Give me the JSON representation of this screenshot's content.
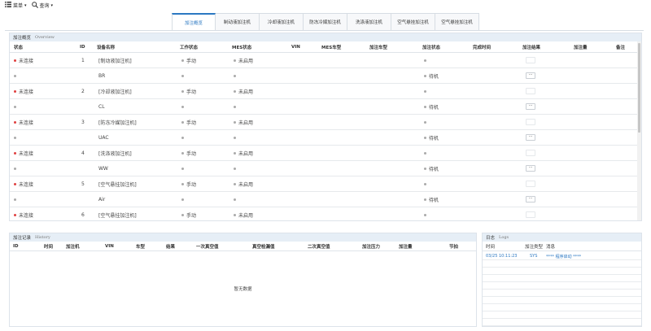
{
  "menubar": {
    "menu_label": "菜单",
    "query_label": "查询"
  },
  "tabs": [
    "加注概览",
    "制动液加注机",
    "冷却液加注机",
    "防冻冷媒加注机",
    "洗涤液加注机",
    "空气悬挂加注机",
    "空气悬挂加注机"
  ],
  "overview": {
    "title": "加注概览",
    "title_en": "Overview",
    "columns": [
      "状态",
      "ID",
      "设备名称",
      "工作状态",
      "MES状态",
      "VIN",
      "MES车型",
      "加注车型",
      "加注状态",
      "完成时间",
      "加注结果",
      "加注量",
      "备注"
    ],
    "rows": [
      {
        "status": "未连接",
        "status_dot": "red",
        "id": "1",
        "name": "[制动液加注机]",
        "work": "手动",
        "mes": "未启用",
        "fill_state": "",
        "button": "empty"
      },
      {
        "status": "",
        "status_dot": "gray",
        "id": "",
        "name": "BR",
        "work": "",
        "mes": "",
        "fill_state": "待机",
        "button": "dots"
      },
      {
        "status": "未连接",
        "status_dot": "red",
        "id": "2",
        "name": "[冷却液加注机]",
        "work": "手动",
        "mes": "未启用",
        "fill_state": "",
        "button": "empty"
      },
      {
        "status": "",
        "status_dot": "gray",
        "id": "",
        "name": "CL",
        "work": "",
        "mes": "",
        "fill_state": "待机",
        "button": "dots"
      },
      {
        "status": "未连接",
        "status_dot": "red",
        "id": "3",
        "name": "[防冻冷媒加注机]",
        "work": "手动",
        "mes": "未启用",
        "fill_state": "",
        "button": "empty"
      },
      {
        "status": "",
        "status_dot": "gray",
        "id": "",
        "name": "UAC",
        "work": "",
        "mes": "",
        "fill_state": "待机",
        "button": "dots"
      },
      {
        "status": "未连接",
        "status_dot": "red",
        "id": "4",
        "name": "[洗涤液加注机]",
        "work": "手动",
        "mes": "未启用",
        "fill_state": "",
        "button": "empty"
      },
      {
        "status": "",
        "status_dot": "gray",
        "id": "",
        "name": "WW",
        "work": "",
        "mes": "",
        "fill_state": "待机",
        "button": "dots"
      },
      {
        "status": "未连接",
        "status_dot": "red",
        "id": "5",
        "name": "[空气悬挂加注机]",
        "work": "手动",
        "mes": "未启用",
        "fill_state": "",
        "button": "empty"
      },
      {
        "status": "",
        "status_dot": "gray",
        "id": "",
        "name": "Air",
        "work": "",
        "mes": "",
        "fill_state": "待机",
        "button": "dots"
      },
      {
        "status": "未连接",
        "status_dot": "red",
        "id": "6",
        "name": "[空气悬挂加注机]",
        "work": "手动",
        "mes": "未启用",
        "fill_state": "",
        "button": "empty"
      },
      {
        "status": "",
        "status_dot": "gray",
        "id": "",
        "name": "Air",
        "work": "",
        "mes": "",
        "fill_state": "待机",
        "button": "dots"
      }
    ]
  },
  "history": {
    "title": "加注记录",
    "title_en": "History",
    "columns": [
      "ID",
      "时间",
      "加注机",
      "VIN",
      "车型",
      "结果",
      "一次真空值",
      "真空检漏值",
      "二次真空值",
      "加注压力",
      "加注量",
      "节拍"
    ],
    "empty_text": "暂无数据"
  },
  "logs": {
    "title": "日志",
    "title_en": "Logs",
    "columns": [
      "时间",
      "加注类型",
      "消息"
    ],
    "entries": [
      {
        "time": "03/25 10:11:23",
        "type": "SYS",
        "message": "**** 程序启动 ****"
      }
    ]
  },
  "colors": {
    "accent": "#2b78c2",
    "status_red": "#e04040",
    "status_gray": "#aaaaaa",
    "header_bg": "#e6eef6"
  }
}
